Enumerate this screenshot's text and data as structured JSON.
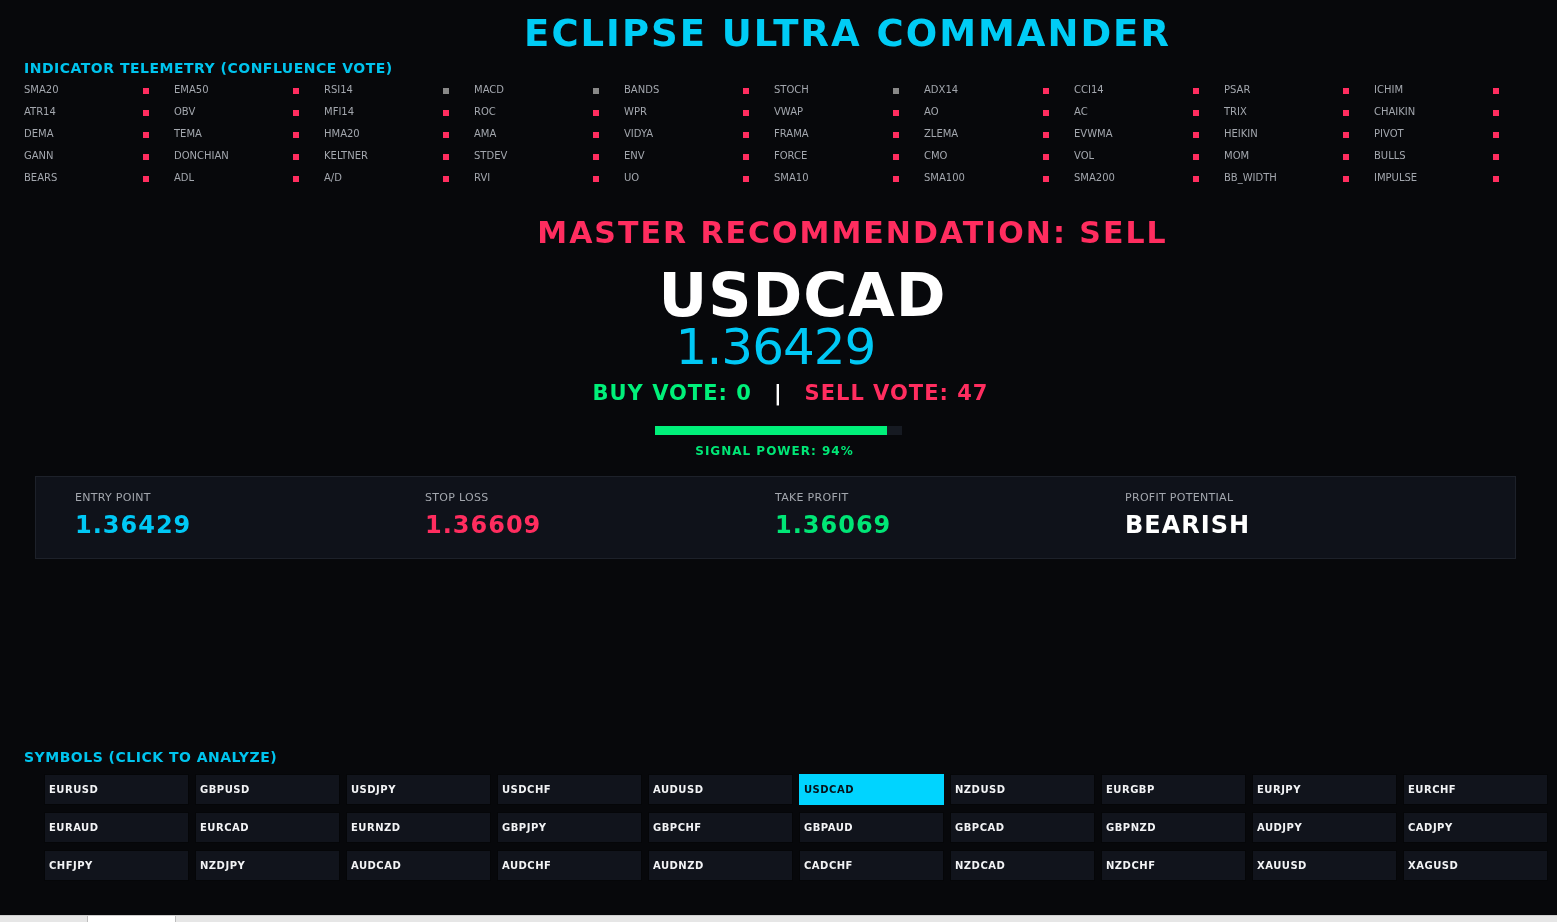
{
  "header": {
    "title": "ECLIPSE ULTRA COMMANDER"
  },
  "telemetry": {
    "title": "INDICATOR TELEMETRY (CONFLUENCE VOTE)",
    "indicators": [
      {
        "name": "SMA20",
        "color": "#ff2d5f"
      },
      {
        "name": "EMA50",
        "color": "#ff2d5f"
      },
      {
        "name": "RSI14",
        "color": "#888888"
      },
      {
        "name": "MACD",
        "color": "#888888"
      },
      {
        "name": "BANDS",
        "color": "#ff2d5f"
      },
      {
        "name": "STOCH",
        "color": "#888888"
      },
      {
        "name": "ADX14",
        "color": "#ff2d5f"
      },
      {
        "name": "CCI14",
        "color": "#ff2d5f"
      },
      {
        "name": "PSAR",
        "color": "#ff2d5f"
      },
      {
        "name": "ICHIM",
        "color": "#ff2d5f"
      },
      {
        "name": "ATR14",
        "color": "#ff2d5f"
      },
      {
        "name": "OBV",
        "color": "#ff2d5f"
      },
      {
        "name": "MFI14",
        "color": "#ff2d5f"
      },
      {
        "name": "ROC",
        "color": "#ff2d5f"
      },
      {
        "name": "WPR",
        "color": "#ff2d5f"
      },
      {
        "name": "VWAP",
        "color": "#ff2d5f"
      },
      {
        "name": "AO",
        "color": "#ff2d5f"
      },
      {
        "name": "AC",
        "color": "#ff2d5f"
      },
      {
        "name": "TRIX",
        "color": "#ff2d5f"
      },
      {
        "name": "CHAIKIN",
        "color": "#ff2d5f"
      },
      {
        "name": "DEMA",
        "color": "#ff2d5f"
      },
      {
        "name": "TEMA",
        "color": "#ff2d5f"
      },
      {
        "name": "HMA20",
        "color": "#ff2d5f"
      },
      {
        "name": "AMA",
        "color": "#ff2d5f"
      },
      {
        "name": "VIDYA",
        "color": "#ff2d5f"
      },
      {
        "name": "FRAMA",
        "color": "#ff2d5f"
      },
      {
        "name": "ZLEMA",
        "color": "#ff2d5f"
      },
      {
        "name": "EVWMA",
        "color": "#ff2d5f"
      },
      {
        "name": "HEIKIN",
        "color": "#ff2d5f"
      },
      {
        "name": "PIVOT",
        "color": "#ff2d5f"
      },
      {
        "name": "GANN",
        "color": "#ff2d5f"
      },
      {
        "name": "DONCHIAN",
        "color": "#ff2d5f"
      },
      {
        "name": "KELTNER",
        "color": "#ff2d5f"
      },
      {
        "name": "STDEV",
        "color": "#ff2d5f"
      },
      {
        "name": "ENV",
        "color": "#ff2d5f"
      },
      {
        "name": "FORCE",
        "color": "#ff2d5f"
      },
      {
        "name": "CMO",
        "color": "#ff2d5f"
      },
      {
        "name": "VOL",
        "color": "#ff2d5f"
      },
      {
        "name": "MOM",
        "color": "#ff2d5f"
      },
      {
        "name": "BULLS",
        "color": "#ff2d5f"
      },
      {
        "name": "BEARS",
        "color": "#ff2d5f"
      },
      {
        "name": "ADL",
        "color": "#ff2d5f"
      },
      {
        "name": "A/D",
        "color": "#ff2d5f"
      },
      {
        "name": "RVI",
        "color": "#ff2d5f"
      },
      {
        "name": "UO",
        "color": "#ff2d5f"
      },
      {
        "name": "SMA10",
        "color": "#ff2d5f"
      },
      {
        "name": "SMA100",
        "color": "#ff2d5f"
      },
      {
        "name": "SMA200",
        "color": "#ff2d5f"
      },
      {
        "name": "BB_WIDTH",
        "color": "#ff2d5f"
      },
      {
        "name": "IMPULSE",
        "color": "#ff2d5f"
      }
    ]
  },
  "recommendation": {
    "headline": "MASTER RECOMMENDATION: SELL",
    "symbol": "USDCAD",
    "price": "1.36429",
    "votes": {
      "buy": "BUY VOTE: 0",
      "separator": "|",
      "sell": "SELL VOTE: 47"
    },
    "signal_power": {
      "level": 0.94,
      "label": "SIGNAL POWER: 94%"
    }
  },
  "levels": [
    {
      "label": "ENTRY POINT",
      "value": "1.36429",
      "color": "#00c8f5"
    },
    {
      "label": "STOP LOSS",
      "value": "1.36609",
      "color": "#ff2d5f"
    },
    {
      "label": "TAKE PROFIT",
      "value": "1.36069",
      "color": "#00e676"
    },
    {
      "label": "PROFIT POTENTIAL",
      "value": "BEARISH",
      "color": "#ffffff"
    }
  ],
  "symbols": {
    "title": "SYMBOLS (CLICK TO ANALYZE)",
    "items": [
      {
        "label": "EURUSD",
        "selected": false
      },
      {
        "label": "GBPUSD",
        "selected": false
      },
      {
        "label": "USDJPY",
        "selected": false
      },
      {
        "label": "USDCHF",
        "selected": false
      },
      {
        "label": "AUDUSD",
        "selected": false
      },
      {
        "label": "USDCAD",
        "selected": true
      },
      {
        "label": "NZDUSD",
        "selected": false
      },
      {
        "label": "EURGBP",
        "selected": false
      },
      {
        "label": "EURJPY",
        "selected": false
      },
      {
        "label": "EURCHF",
        "selected": false
      },
      {
        "label": "EURAUD",
        "selected": false
      },
      {
        "label": "EURCAD",
        "selected": false
      },
      {
        "label": "EURNZD",
        "selected": false
      },
      {
        "label": "GBPJPY",
        "selected": false
      },
      {
        "label": "GBPCHF",
        "selected": false
      },
      {
        "label": "GBPAUD",
        "selected": false
      },
      {
        "label": "GBPCAD",
        "selected": false
      },
      {
        "label": "GBPNZD",
        "selected": false
      },
      {
        "label": "AUDJPY",
        "selected": false
      },
      {
        "label": "CADJPY",
        "selected": false
      },
      {
        "label": "CHFJPY",
        "selected": false
      },
      {
        "label": "NZDJPY",
        "selected": false
      },
      {
        "label": "AUDCAD",
        "selected": false
      },
      {
        "label": "AUDCHF",
        "selected": false
      },
      {
        "label": "AUDNZD",
        "selected": false
      },
      {
        "label": "CADCHF",
        "selected": false
      },
      {
        "label": "NZDCAD",
        "selected": false
      },
      {
        "label": "NZDCHF",
        "selected": false
      },
      {
        "label": "XAUUSD",
        "selected": false
      },
      {
        "label": "XAGUSD",
        "selected": false
      }
    ]
  }
}
